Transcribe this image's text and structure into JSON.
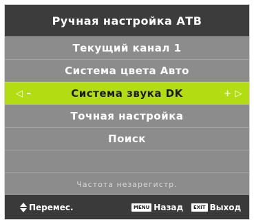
{
  "menu": {
    "title": "Ручная настройка АТВ",
    "items": [
      {
        "label": "Текущий канал 1"
      },
      {
        "label": "Система цвета Авто"
      },
      {
        "label": "Система звука DK"
      },
      {
        "label": "Точная настройка"
      },
      {
        "label": "Поиск"
      },
      {
        "label": ""
      },
      {
        "label": "Частота незарегистр."
      }
    ],
    "left_arrow_glyph": "◁ –",
    "right_arrow_glyph": "+ ▷"
  },
  "footer": {
    "move_label": "Перемес.",
    "menu_key": "MENU",
    "back_label": "Назад",
    "exit_key": "EXIT",
    "exit_label": "Выход"
  },
  "colors": {
    "highlight": "#b4dc12",
    "row": "#8c8c8c",
    "background": "#3a3a3a"
  }
}
